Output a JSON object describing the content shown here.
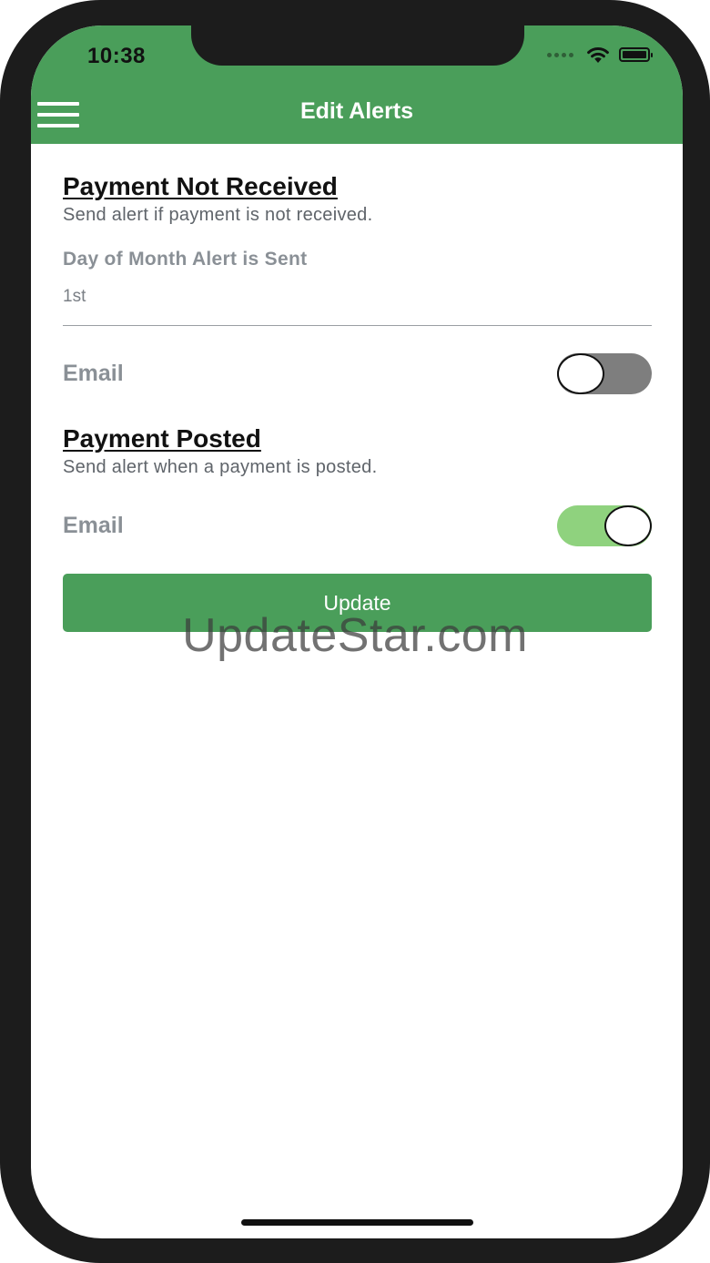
{
  "status_bar": {
    "time": "10:38",
    "icons": [
      "signal-dots-icon",
      "wifi-icon",
      "battery-icon"
    ]
  },
  "nav": {
    "title": "Edit Alerts",
    "menu_icon": "hamburger-menu-icon"
  },
  "sections": [
    {
      "title": "Payment Not Received",
      "description": "Send alert if payment is not received.",
      "field_label": "Day of Month Alert is Sent",
      "field_value": "1st",
      "toggle_label": "Email",
      "toggle_on": false
    },
    {
      "title": "Payment Posted",
      "description": "Send alert when a payment is posted.",
      "toggle_label": "Email",
      "toggle_on": true
    }
  ],
  "update_button": {
    "label": "Update"
  },
  "watermark": "UpdateStar.com",
  "colors": {
    "brand_green": "#4a9e5a",
    "toggle_on": "#8fd27e",
    "toggle_off": "#7e7e7e"
  }
}
